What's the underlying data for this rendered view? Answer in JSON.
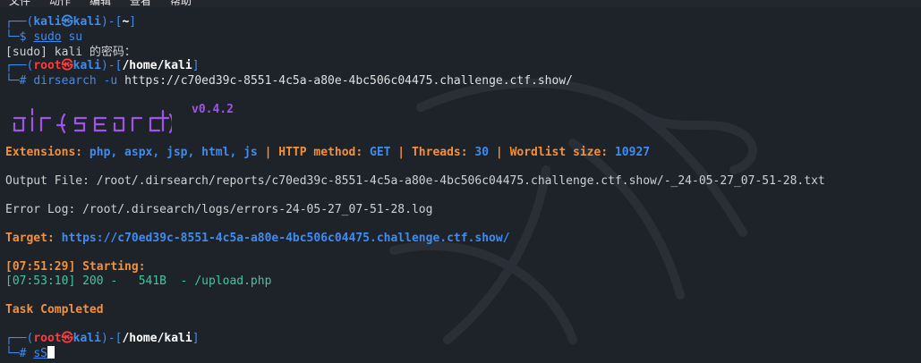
{
  "menu": {
    "file": "文件",
    "action": "动作",
    "edit": "编辑",
    "view": "查看",
    "help": "帮助"
  },
  "prompt1": {
    "open": "┌──(",
    "user": "kali",
    "at": "㉿",
    "host": "kali",
    "close": ")-[",
    "dir": "~",
    "end": "]",
    "dollar": "└─$ ",
    "cmd": "sudo",
    "arg": " su"
  },
  "sudo_prompt": "[sudo] kali 的密码：",
  "prompt2": {
    "open": "┌──(",
    "user": "root",
    "at": "㉿",
    "host": "kali",
    "close": ")-[",
    "dir": "/home/kali",
    "end": "]",
    "hash": "└─# ",
    "cmd": "dirsearch",
    "flag": " -u ",
    "url": "https://c70ed39c-8551-4c5a-a80e-4bc506c04475.challenge.ctf.show/"
  },
  "banner": {
    "version": "v0.4.2"
  },
  "config": {
    "extensions_label": "Extensions: ",
    "extensions_value": "php, aspx, jsp, html, js",
    "sep1": " | ",
    "method_label": "HTTP method: ",
    "method_value": "GET",
    "sep2": " | ",
    "threads_label": "Threads: ",
    "threads_value": "30",
    "sep3": " | ",
    "wordlist_label": "Wordlist size: ",
    "wordlist_value": "10927"
  },
  "output_file": "Output File: /root/.dirsearch/reports/c70ed39c-8551-4c5a-a80e-4bc506c04475.challenge.ctf.show/-_24-05-27_07-51-28.txt",
  "error_log": "Error Log: /root/.dirsearch/logs/errors-24-05-27_07-51-28.log",
  "target": {
    "label": "Target: ",
    "url": "https://c70ed39c-8551-4c5a-a80e-4bc506c04475.challenge.ctf.show/"
  },
  "starting": "[07:51:29] Starting:",
  "result": "[07:53:10] 200 -   541B  - /upload.php",
  "task_completed": "Task Completed",
  "prompt3": {
    "open": "┌──(",
    "user": "root",
    "at": "㉿",
    "host": "kali",
    "close": ")-[",
    "dir": "/home/kali",
    "end": "]",
    "hash": "└─# ",
    "input": "sS"
  },
  "colors": {
    "background": "#1e2229",
    "prompt_blue": "#3f8cf0",
    "root_red": "#ff3b3b",
    "orange": "#f5903a",
    "green": "#41c7a0",
    "purple": "#a054e8"
  }
}
